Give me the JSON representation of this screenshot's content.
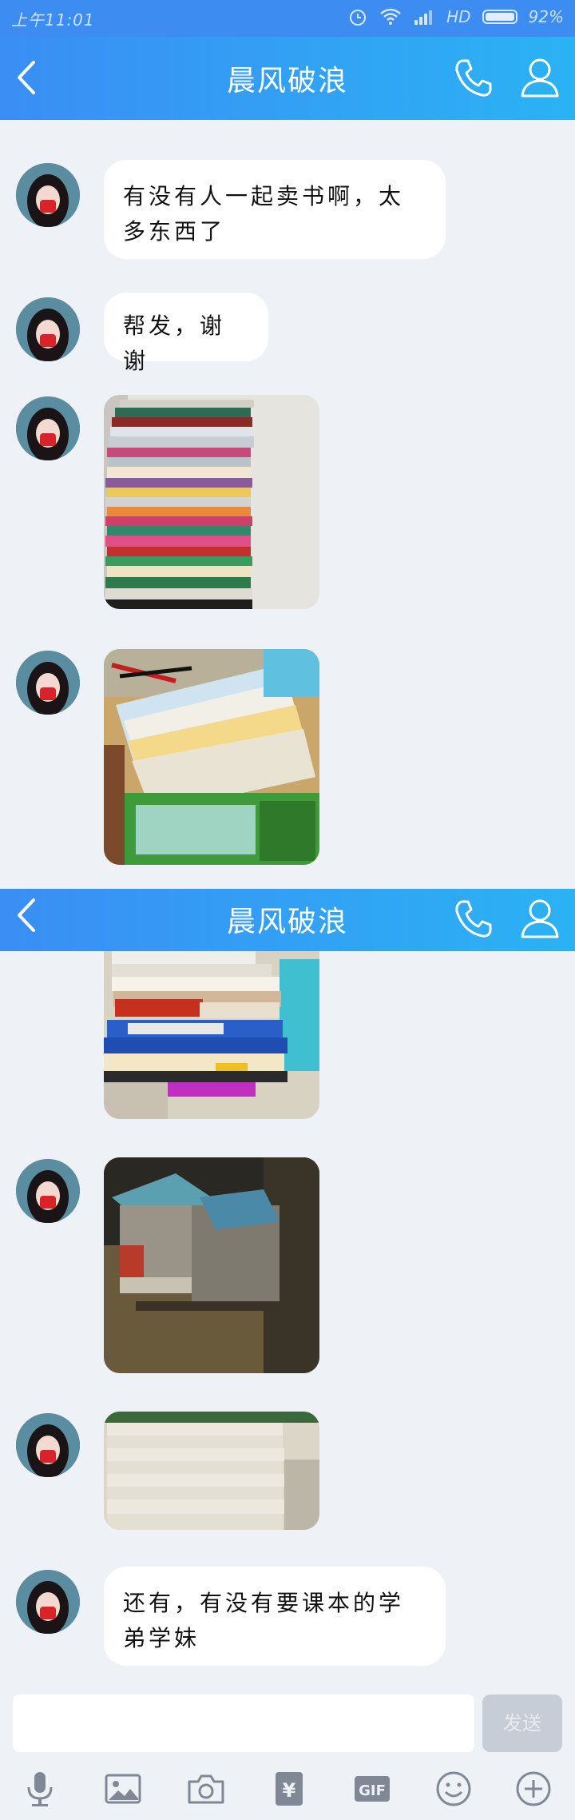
{
  "status_bar": {
    "time": "上午11:01",
    "network": "HD",
    "battery": "92%",
    "battery_level": 0.92
  },
  "header": {
    "title": "晨风破浪"
  },
  "messages": [
    {
      "type": "text",
      "text": "有没有人一起卖书啊，太多东西了"
    },
    {
      "type": "text",
      "text": "帮发，谢谢"
    },
    {
      "type": "image",
      "content": "stack of books"
    },
    {
      "type": "image",
      "content": "books on desk"
    },
    {
      "type": "image",
      "content": "stack of study books"
    },
    {
      "type": "image",
      "content": "stack of magazines"
    },
    {
      "type": "image",
      "content": "stack of books with spines"
    },
    {
      "type": "text",
      "text": "还有，有没有要课本的学弟学妹"
    }
  ],
  "input": {
    "send_label": "发送",
    "placeholder": ""
  },
  "toolbar": {
    "items": [
      "microphone-icon",
      "image-icon",
      "camera-icon",
      "red-packet-icon",
      "gif-icon",
      "emoji-icon",
      "plus-icon"
    ],
    "gif_label": "GIF",
    "yuan_label": "¥"
  },
  "colors": {
    "header_start": "#3a8ef4",
    "header_end": "#2bb2f4",
    "background": "#eef1f6",
    "bubble": "#ffffff"
  }
}
